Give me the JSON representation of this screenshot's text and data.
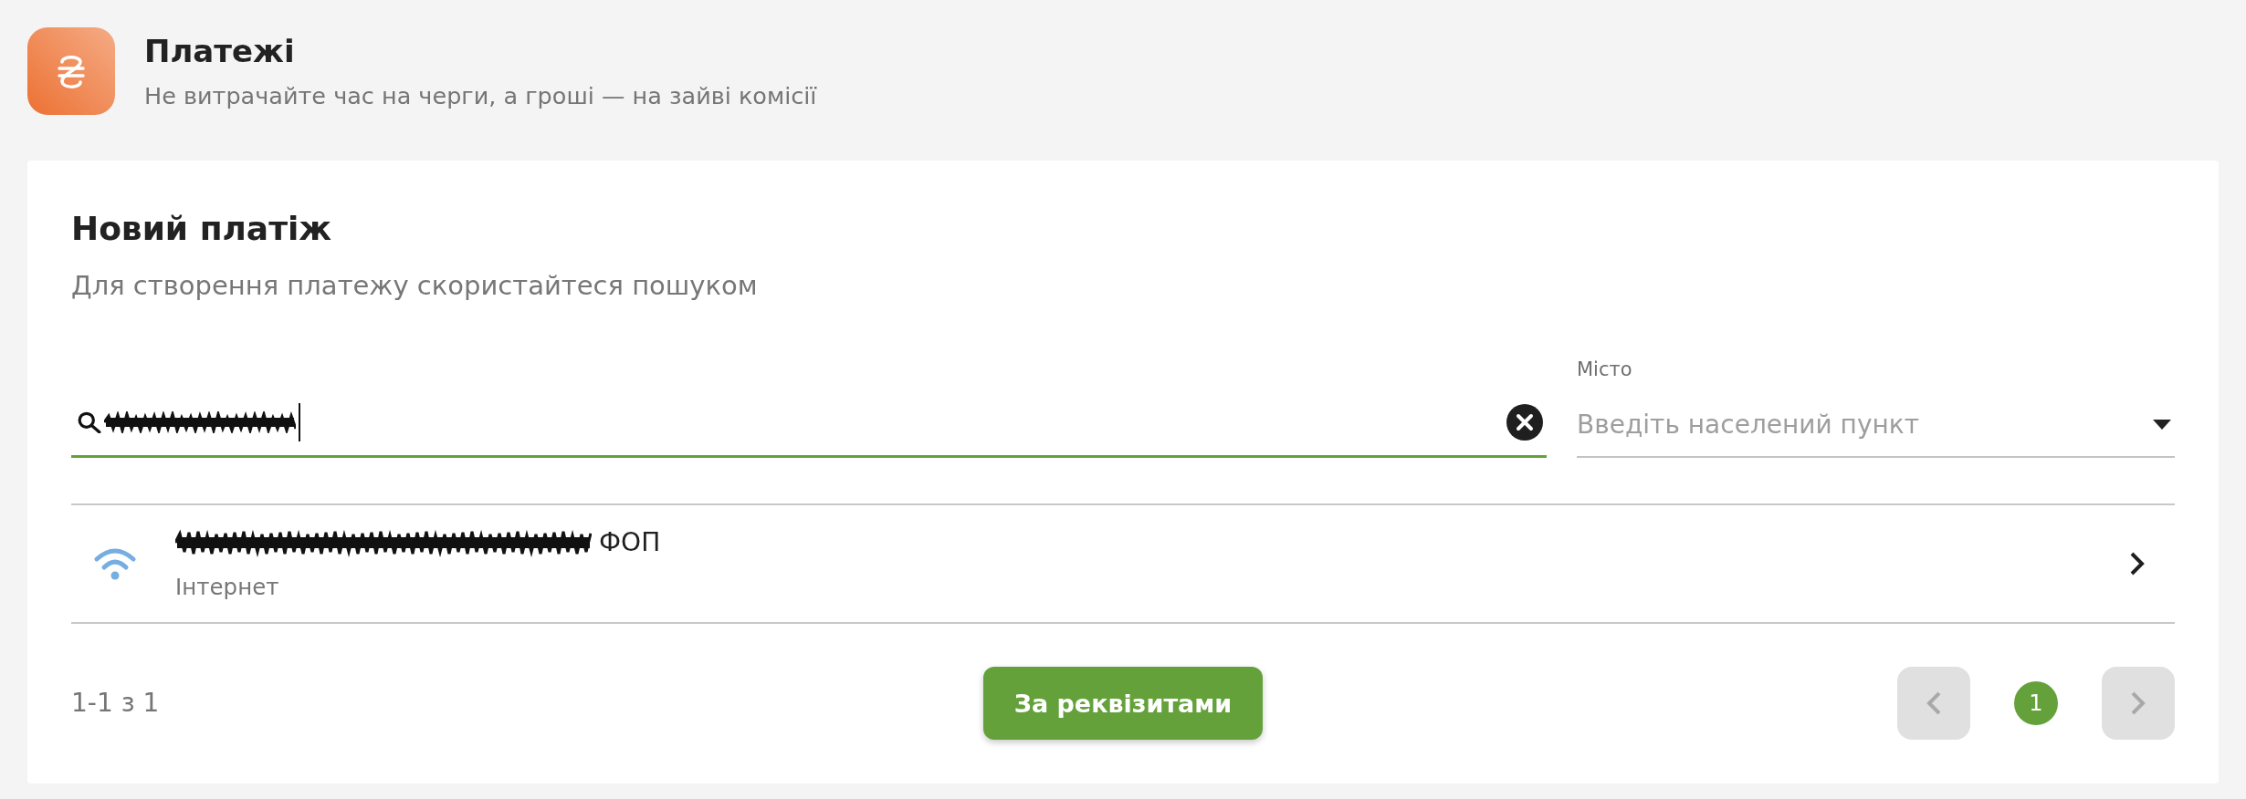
{
  "header": {
    "title": "Платежі",
    "subtitle": "Не витрачайте час на черги, а гроші — на зайві комісії"
  },
  "card": {
    "title": "Новий платіж",
    "subtitle": "Для створення платежу скористайтеся пошуком"
  },
  "search": {
    "value_redacted": true,
    "focused": true
  },
  "city": {
    "label": "Місто",
    "placeholder": "Введіть населений пункт"
  },
  "results": [
    {
      "title": "ФОП",
      "title_redacted": true,
      "category": "Інтернет"
    }
  ],
  "footer": {
    "range": "1-1 з 1",
    "button": "За реквізитами"
  },
  "pagination": {
    "previous": {
      "disabled": true
    },
    "pages": [
      {
        "label": "1",
        "selected": true
      }
    ],
    "next": {
      "disabled": true
    }
  }
}
